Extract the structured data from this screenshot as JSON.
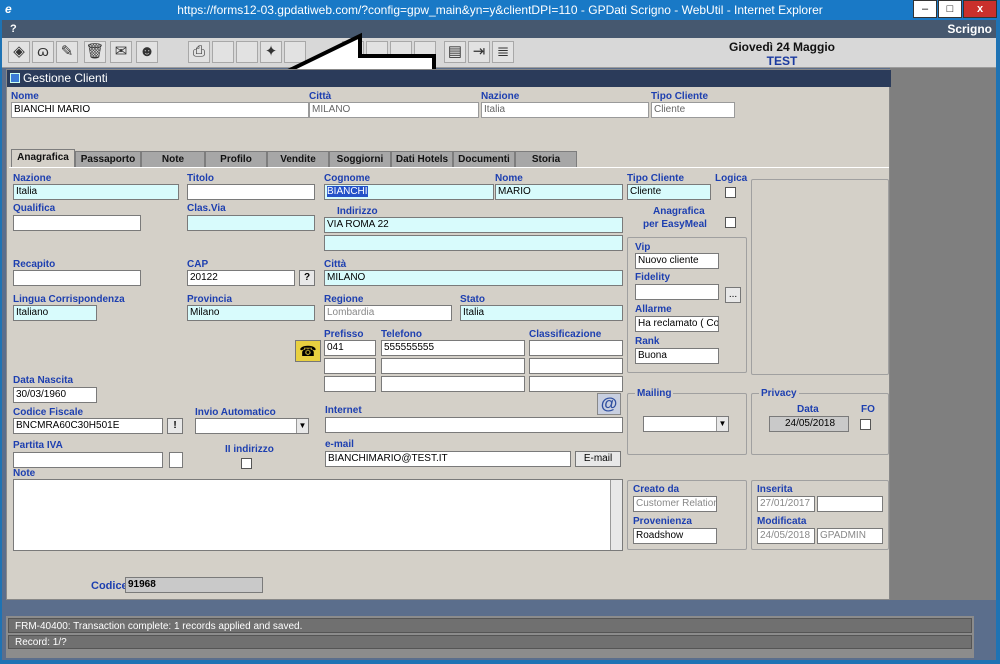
{
  "window": {
    "title": "https://forms12-03.gpdatiweb.com/?config=gpw_main&yn=y&clientDPI=110 - GPDati Scrigno - WebUtil - Internet Explorer",
    "minimize": "–",
    "maximize": "□",
    "close": "x"
  },
  "menubar": {
    "help": "?",
    "app": "Scrigno"
  },
  "header": {
    "date": "Giovedì 24 Maggio",
    "env": "TEST"
  },
  "form": {
    "title": "Gestione Clienti",
    "search": {
      "nome_label": "Nome",
      "nome_value": "BIANCHI MARIO",
      "citta_label": "Città",
      "citta_value": "MILANO",
      "nazione_label": "Nazione",
      "nazione_value": "Italia",
      "tipo_label": "Tipo Cliente",
      "tipo_value": "Cliente"
    },
    "tabs": [
      "Anagrafica",
      "Passaporto",
      "Note",
      "Profilo",
      "Vendite",
      "Soggiorni",
      "Dati Hotels",
      "Documenti",
      "Storia"
    ],
    "anagrafica": {
      "nazione_label": "Nazione",
      "nazione": "Italia",
      "titolo_label": "Titolo",
      "titolo": "",
      "cognome_label": "Cognome",
      "cognome": "BIANCHI",
      "nome_label": "Nome",
      "nome": "MARIO",
      "tipo_label": "Tipo Cliente",
      "tipo": "Cliente",
      "logica_label": "Logica",
      "qualifica_label": "Qualifica",
      "clasvia_label": "Clas.Via",
      "indirizzo_label": "Indirizzo",
      "indirizzo": "VIA ROMA 22",
      "easymeal_label1": "Anagrafica",
      "easymeal_label2": "per EasyMeal",
      "recapito_label": "Recapito",
      "cap_label": "CAP",
      "cap": "20122",
      "cap_btn": "?",
      "citta_label": "Città",
      "citta": "MILANO",
      "lingua_label": "Lingua Corrispondenza",
      "lingua": "Italiano",
      "provincia_label": "Provincia",
      "provincia": "Milano",
      "regione_label": "Regione",
      "regione": "Lombardia",
      "stato_label": "Stato",
      "stato": "Italia",
      "prefisso_label": "Prefisso",
      "prefisso": "041",
      "telefono_label": "Telefono",
      "telefono": "555555555",
      "classificazione_label": "Classificazione",
      "vip_label": "Vip",
      "vip": "Nuovo cliente",
      "fidelity_label": "Fidelity",
      "fidelity_btn": "...",
      "allarme_label": "Allarme",
      "allarme": "Ha reclamato ( Cor",
      "rank_label": "Rank",
      "rank": "Buona",
      "datanascita_label": "Data Nascita",
      "datanascita": "30/03/1960",
      "cf_label": "Codice Fiscale",
      "cf": "BNCMRA60C30H501E",
      "cf_btn": "!",
      "invio_label": "Invio Automatico",
      "internet_label": "Internet",
      "mailing_label": "Mailing",
      "privacy_label": "Privacy",
      "privacy_data_label": "Data",
      "privacy_fo_label": "FO",
      "privacy_data": "24/05/2018",
      "piva_label": "Partita IVA",
      "iiindirizzo_label": "II indirizzo",
      "email_label": "e-mail",
      "email": "BIANCHIMARIO@TEST.IT",
      "email_btn": "E-mail",
      "note_label": "Note",
      "creato_label": "Creato da",
      "creato": "Customer Relation",
      "inserita_label": "Inserita",
      "inserita": "27/01/2017",
      "provenienza_label": "Provenienza",
      "provenienza": "Roadshow",
      "modificata_label": "Modificata",
      "modificata": "24/05/2018",
      "modificata_by": "GPADMIN",
      "codice_label": "Codice",
      "codice": "91968"
    }
  },
  "status": {
    "message": "FRM-40400: Transaction complete: 1 records applied and saved.",
    "record": "Record: 1/?"
  }
}
